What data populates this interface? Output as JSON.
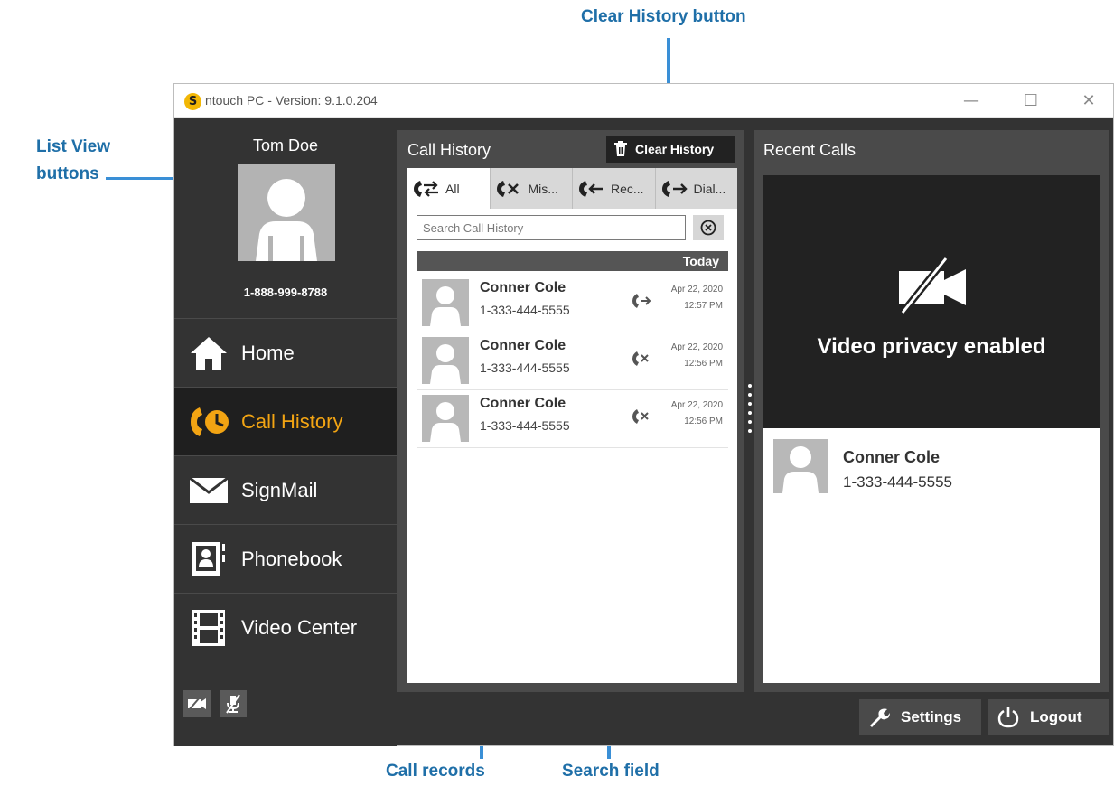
{
  "annotations": {
    "clear_history": "Clear History button",
    "list_view_line1": "List View",
    "list_view_line2": "buttons",
    "call_records": "Call records",
    "search_field": "Search field"
  },
  "window": {
    "title": "ntouch PC  -  Version:  9.1.0.204",
    "minimize": "—",
    "maximize": "☐",
    "close": "✕"
  },
  "user": {
    "name": "Tom Doe",
    "phone": "1-888-999-8788"
  },
  "nav": {
    "items": [
      {
        "label": "Home",
        "icon": "home-icon"
      },
      {
        "label": "Call History",
        "icon": "call-history-icon",
        "active": true
      },
      {
        "label": "SignMail",
        "icon": "envelope-icon"
      },
      {
        "label": "Phonebook",
        "icon": "phonebook-icon"
      },
      {
        "label": "Video Center",
        "icon": "film-icon"
      }
    ]
  },
  "call_history": {
    "title": "Call History",
    "clear_label": "Clear History",
    "tabs": [
      {
        "label": "All",
        "icon": "all-calls-icon",
        "active": true
      },
      {
        "label": "Mis...",
        "icon": "missed-calls-icon"
      },
      {
        "label": "Rec...",
        "icon": "received-calls-icon"
      },
      {
        "label": "Dial...",
        "icon": "dialed-calls-icon"
      }
    ],
    "search_placeholder": "Search Call History",
    "date_header": "Today",
    "records": [
      {
        "name": "Conner Cole",
        "phone": "1-333-444-5555",
        "date": "Apr 22, 2020",
        "time": "12:57 PM",
        "type": "dialed"
      },
      {
        "name": "Conner Cole",
        "phone": "1-333-444-5555",
        "date": "Apr 22, 2020",
        "time": "12:56 PM",
        "type": "missed"
      },
      {
        "name": "Conner Cole",
        "phone": "1-333-444-5555",
        "date": "Apr 22, 2020",
        "time": "12:56 PM",
        "type": "missed"
      }
    ]
  },
  "recent_calls": {
    "title": "Recent Calls",
    "video_status": "Video privacy enabled",
    "items": [
      {
        "name": "Conner Cole",
        "phone": "1-333-444-5555"
      }
    ]
  },
  "footer": {
    "settings_label": "Settings",
    "logout_label": "Logout"
  },
  "colors": {
    "accent": "#f2a413",
    "annotation": "#1f6fa8",
    "sidebar_bg": "#333333",
    "panel_bg": "#4a4a4a"
  }
}
